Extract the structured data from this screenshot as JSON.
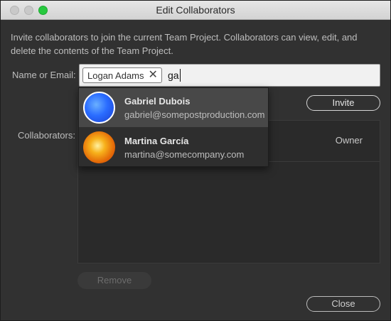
{
  "window": {
    "title": "Edit Collaborators"
  },
  "description": "Invite collaborators to join the current Team Project. Collaborators can view, edit, and delete the contents of the Team Project.",
  "form": {
    "name_label": "Name or Email:",
    "token_label": "Logan Adams",
    "token_remove_glyph": "✕",
    "typed_text": "ga",
    "invite_label": "Invite"
  },
  "suggestions": [
    {
      "name": "Gabriel Dubois",
      "email": "gabriel@somepostproduction.com",
      "highlighted": true
    },
    {
      "name": "Martina García",
      "email": "martina@somecompany.com",
      "highlighted": false
    }
  ],
  "collaborators": {
    "label": "Collaborators:",
    "rows": [
      {
        "role": "Owner"
      }
    ]
  },
  "buttons": {
    "remove": "Remove",
    "close": "Close"
  },
  "colors": {
    "highlight": "#484848",
    "maximize": "#27c93f"
  }
}
